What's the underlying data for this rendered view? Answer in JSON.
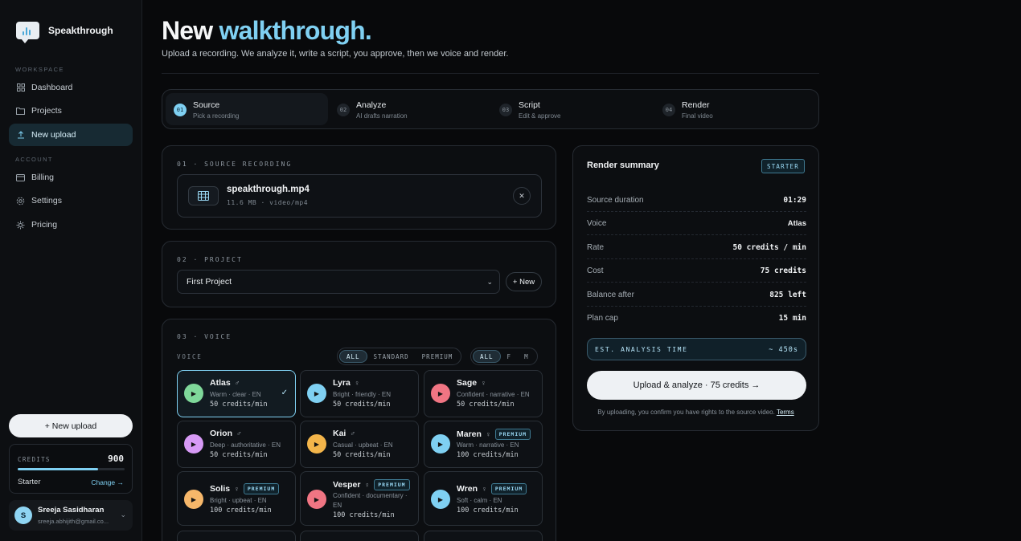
{
  "brand": {
    "name": "Speakthrough"
  },
  "sidebar": {
    "workspace_label": "WORKSPACE",
    "workspace_items": [
      {
        "label": "Dashboard",
        "icon": "grid-icon"
      },
      {
        "label": "Projects",
        "icon": "folder-icon"
      },
      {
        "label": "New upload",
        "icon": "upload-icon",
        "active": true
      }
    ],
    "account_label": "ACCOUNT",
    "account_items": [
      {
        "label": "Billing",
        "icon": "card-icon"
      },
      {
        "label": "Settings",
        "icon": "gear-icon"
      },
      {
        "label": "Pricing",
        "icon": "sparkle-icon"
      }
    ],
    "new_upload_button": "+ New upload",
    "credits": {
      "label": "CREDITS",
      "value": "900",
      "fill_fraction": 0.75,
      "plan": "Starter",
      "change": "Change →"
    },
    "user": {
      "initial": "S",
      "name": "Sreeja Sasidharan",
      "email": "sreeja.abhijith@gmail.co..."
    }
  },
  "header": {
    "title_plain": "New ",
    "title_accent": "walkthrough.",
    "subtitle": "Upload a recording. We analyze it, write a script, you approve, then we voice and render."
  },
  "steps": [
    {
      "num": "01",
      "title": "Source",
      "desc": "Pick a recording",
      "active": true
    },
    {
      "num": "02",
      "title": "Analyze",
      "desc": "AI drafts narration"
    },
    {
      "num": "03",
      "title": "Script",
      "desc": "Edit & approve"
    },
    {
      "num": "04",
      "title": "Render",
      "desc": "Final video"
    }
  ],
  "source": {
    "label": "01 · SOURCE RECORDING",
    "file_name": "speakthrough.mp4",
    "file_meta": "11.6 MB · video/mp4",
    "close": "✕"
  },
  "project": {
    "label": "02 · PROJECT",
    "selected": "First Project",
    "new_button": "+ New"
  },
  "voice": {
    "label": "03 · VOICE",
    "sublabel": "VOICE",
    "tier_filters": [
      "ALL",
      "STANDARD",
      "PREMIUM"
    ],
    "gender_filters": [
      "ALL",
      "F",
      "M"
    ],
    "premium_badge": "PREMIUM",
    "cards": [
      {
        "name": "Atlas",
        "gender": "♂",
        "desc": "Warm · clear · EN",
        "rate": "50 credits/min",
        "color": "#7fd89a",
        "selected": true,
        "premium": false
      },
      {
        "name": "Lyra",
        "gender": "♀",
        "desc": "Bright · friendly · EN",
        "rate": "50 credits/min",
        "color": "#7fd0f2",
        "premium": false
      },
      {
        "name": "Sage",
        "gender": "♀",
        "desc": "Confident · narrative · EN",
        "rate": "50 credits/min",
        "color": "#f07583",
        "premium": false
      },
      {
        "name": "Orion",
        "gender": "♂",
        "desc": "Deep · authoritative · EN",
        "rate": "50 credits/min",
        "color": "#d79af5",
        "premium": false
      },
      {
        "name": "Kai",
        "gender": "♂",
        "desc": "Casual · upbeat · EN",
        "rate": "50 credits/min",
        "color": "#f3b54a",
        "premium": false
      },
      {
        "name": "Maren",
        "gender": "♀",
        "desc": "Warm · narrative · EN",
        "rate": "100 credits/min",
        "color": "#7fd0f2",
        "premium": true
      },
      {
        "name": "Solis",
        "gender": "♀",
        "desc": "Bright · upbeat · EN",
        "rate": "100 credits/min",
        "color": "#f6b76a",
        "premium": true
      },
      {
        "name": "Vesper",
        "gender": "♀",
        "desc": "Confident · documentary · EN",
        "rate": "100 credits/min",
        "color": "#f07583",
        "premium": true
      },
      {
        "name": "Wren",
        "gender": "♀",
        "desc": "Soft · calm · EN",
        "rate": "100 credits/min",
        "color": "#7fd0f2",
        "premium": true
      }
    ]
  },
  "summary": {
    "title": "Render summary",
    "plan_badge": "STARTER",
    "rows": [
      {
        "k": "Source duration",
        "v": "01:29"
      },
      {
        "k": "Voice",
        "v": "Atlas"
      },
      {
        "k": "Rate",
        "v": "50 credits / min"
      },
      {
        "k": "Cost",
        "v": "75 credits"
      },
      {
        "k": "Balance after",
        "v": "825 left"
      },
      {
        "k": "Plan cap",
        "v": "15 min"
      }
    ],
    "est_label": "EST. ANALYSIS TIME",
    "est_value": "~ 450s",
    "cta": "Upload & analyze · 75 credits →",
    "fine_print": "By uploading, you confirm you have rights to the source video.",
    "terms": "Terms"
  }
}
